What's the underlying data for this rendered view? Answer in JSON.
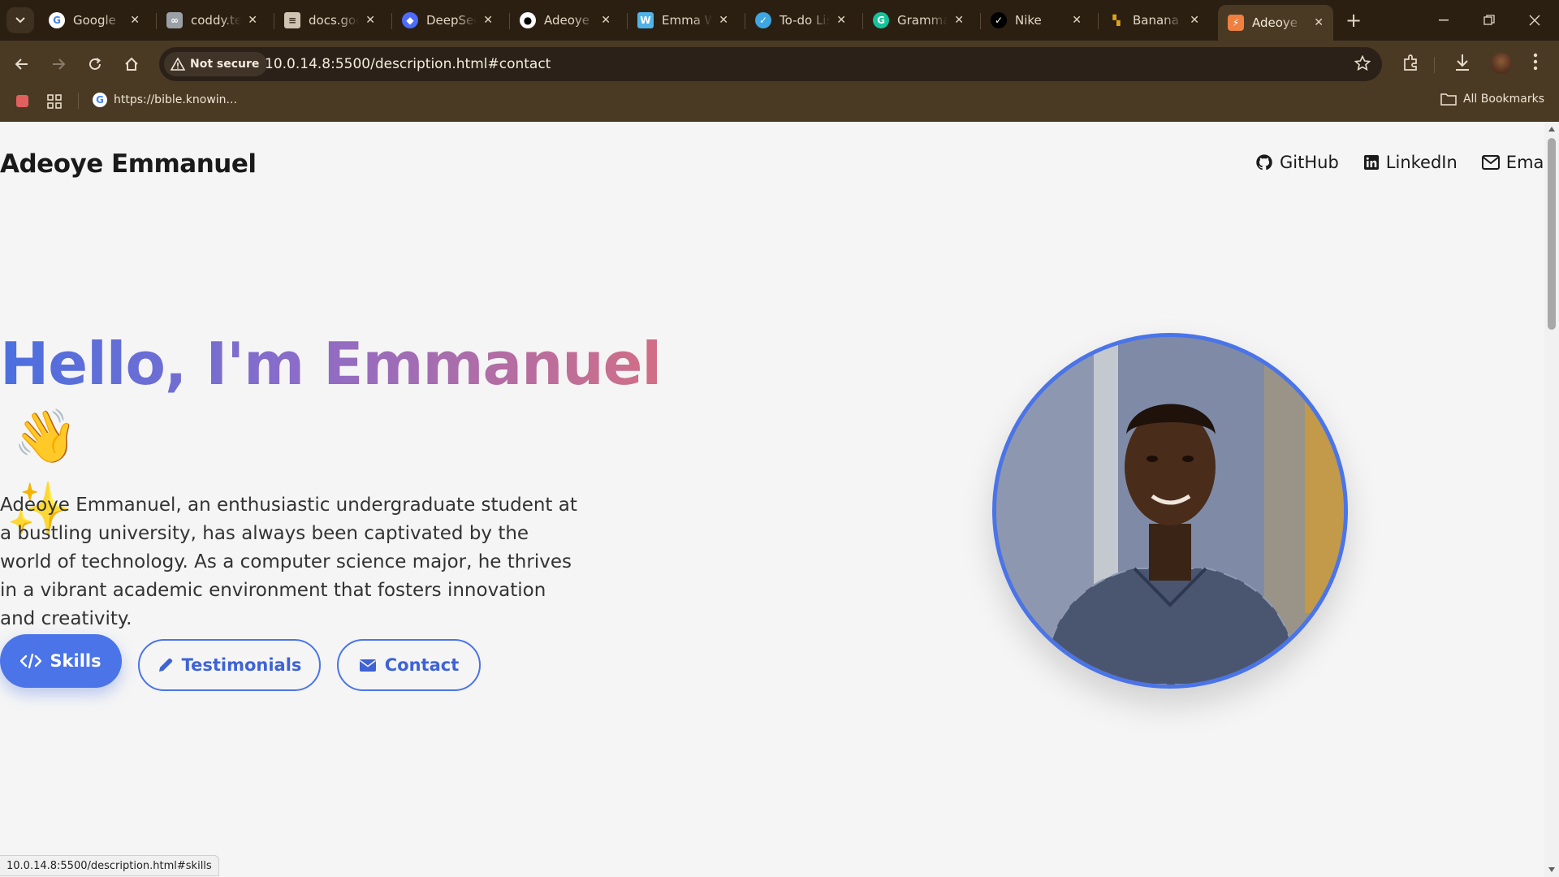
{
  "browser": {
    "tabs": [
      {
        "label": "Google",
        "icon": "google-icon",
        "color": "#4285f4"
      },
      {
        "label": "coddy.tech",
        "icon": "coddy-icon",
        "color": "#9aa0a6"
      },
      {
        "label": "docs.google",
        "icon": "docs-icon",
        "color": "#cfc4b2"
      },
      {
        "label": "DeepSeek",
        "icon": "deepseek-icon",
        "color": "#4d6bfe"
      },
      {
        "label": "Adeoye",
        "icon": "github-icon",
        "color": "#ffffff"
      },
      {
        "label": "Emma W",
        "icon": "word-icon",
        "color": "#4fb3e8"
      },
      {
        "label": "To-do List",
        "icon": "todo-icon",
        "color": "#3ea6e0"
      },
      {
        "label": "Grammarly",
        "icon": "grammarly-icon",
        "color": "#15c39a"
      },
      {
        "label": "Nike",
        "icon": "nike-icon",
        "color": "#000000"
      },
      {
        "label": "Banana",
        "icon": "banana-icon",
        "color": "#e0a020"
      },
      {
        "label": "Adeoye",
        "icon": "page-icon",
        "color": "#f08040",
        "active": true
      }
    ],
    "security_label": "Not secure",
    "url": "10.0.14.8:5500/description.html#contact",
    "bookmark": "https://bible.knowin...",
    "all_bookmarks": "All Bookmarks",
    "status_url": "10.0.14.8:5500/description.html#skills"
  },
  "site": {
    "title": "Adeoye Emmanuel",
    "nav": [
      {
        "label": "GitHub",
        "icon": "github-icon"
      },
      {
        "label": "LinkedIn",
        "icon": "linkedin-icon"
      },
      {
        "label": "Email",
        "icon": "envelope-icon"
      }
    ]
  },
  "hero": {
    "title": "Hello, I'm Emmanuel",
    "wave_emoji": "👋",
    "sparkle_emoji": "✨",
    "description": "Adeoye Emmanuel, an enthusiastic undergraduate student at a bustling university, has always been captivated by the world of technology. As a computer science major, he thrives in a vibrant academic environment that fosters innovation and creativity.",
    "buttons": {
      "skills": "Skills",
      "testimonials": "Testimonials",
      "contact": "Contact"
    },
    "accent_color": "#4a74e8"
  }
}
